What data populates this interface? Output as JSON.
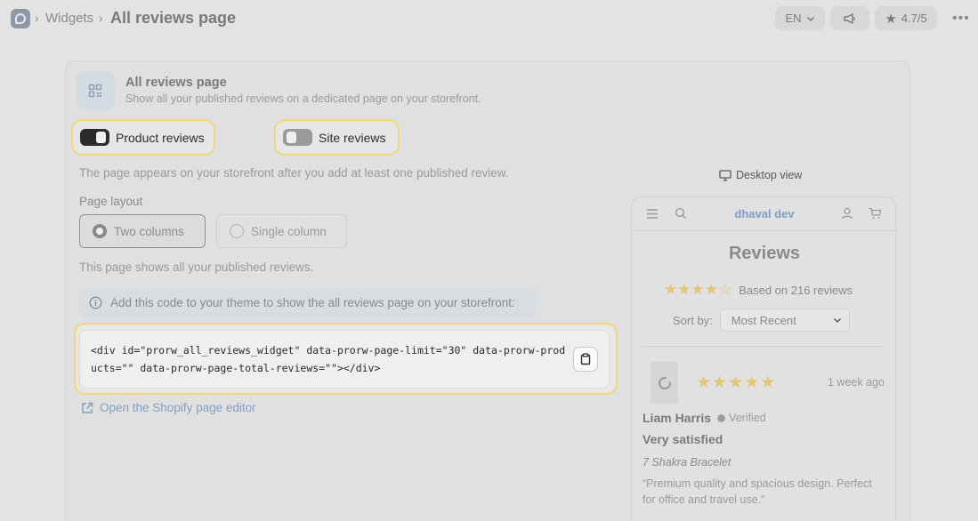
{
  "breadcrumb": {
    "parent": "Widgets",
    "current": "All reviews page",
    "separator": "›"
  },
  "topbar": {
    "language": "EN",
    "rating": "4.7/5"
  },
  "card": {
    "title": "All reviews page",
    "subtitle": "Show all your published reviews on a dedicated page on your storefront."
  },
  "toggles": {
    "product": {
      "label": "Product reviews",
      "on": true
    },
    "site": {
      "label": "Site reviews",
      "on": false
    }
  },
  "storefront_note": "The page appears on your storefront after you add at least one published review.",
  "layout": {
    "label": "Page layout",
    "options": [
      {
        "label": "Two columns",
        "selected": true
      },
      {
        "label": "Single column",
        "selected": false
      }
    ]
  },
  "shows_note": "This page shows all your published reviews.",
  "info_banner": "Add this code to your theme to show the all reviews page on your storefront:",
  "code_snippet": "<div id=\"prorw_all_reviews_widget\" data-prorw-page-limit=\"30\" data-prorw-products=\"\" data-prorw-page-total-reviews=\"\"></div>",
  "editor_link": "Open the Shopify page editor",
  "preview": {
    "view_label": "Desktop view",
    "store_name": "dhaval dev",
    "title": "Reviews",
    "stars_filled": 4,
    "rating_text": "Based on 216 reviews",
    "sort_label": "Sort by:",
    "sort_value": "Most Recent",
    "review": {
      "stars": 5,
      "date": "1 week ago",
      "author": "Liam Harris",
      "verified": "Verified",
      "title": "Very satisfied",
      "product": "7 Shakra Bracelet",
      "body": "“Premium quality and spacious design. Perfect for office and travel use.”"
    }
  },
  "colors": {
    "highlight": "#f2d77a",
    "star": "#e4c476",
    "link": "#7fa0c4"
  }
}
